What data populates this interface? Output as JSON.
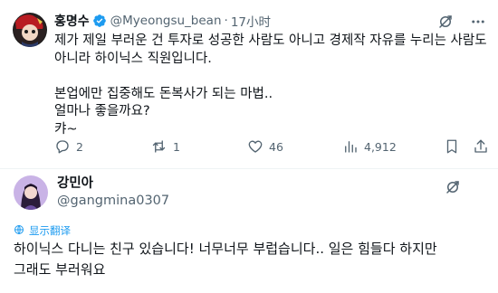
{
  "tweet": {
    "display_name": "홍명수",
    "handle": "@Myeongsu_bean",
    "separator": "·",
    "time": "17小时",
    "lines": [
      "제가 제일 부러운 건 투자로 성공한 사람도 아니고 경제작 자유를 누리는 사람도",
      "아니라 하이닉스 직원입니다."
    ],
    "lines2": [
      "본업에만 집중해도 돈복사가 되는 마법..",
      "얼마나 좋을까요?",
      "캬~"
    ],
    "actions": {
      "replies": "2",
      "retweets": "1",
      "likes": "46",
      "views": "4,912"
    }
  },
  "reply": {
    "display_name": "강민아",
    "handle": "@gangmina0307",
    "translate_label": "显示翻译",
    "lines": [
      "하이닉스 다니는 친구 있습니다! 너무너무 부럽습니다.. 일은 힘들다 하지만",
      "그래도 부러워요"
    ]
  },
  "colors": {
    "text": "#0f1419",
    "secondary": "#536471",
    "accent": "#1d9bf0",
    "divider": "#eff3f4"
  },
  "icons": [
    "grok-icon",
    "more-icon",
    "reply-icon",
    "retweet-icon",
    "like-icon",
    "views-icon",
    "bookmark-icon",
    "share-icon",
    "globe-icon",
    "verified-badge-icon"
  ]
}
